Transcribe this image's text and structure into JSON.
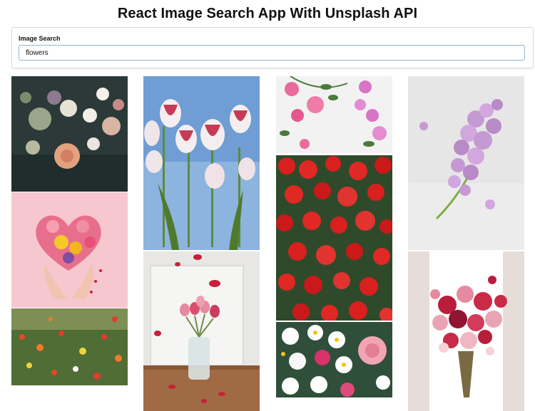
{
  "header": {
    "title": "React Image Search App With Unsplash API"
  },
  "search": {
    "label": "Image Search",
    "value": "flowers"
  },
  "gallery": {
    "photos": [
      {
        "icon": "bouquet-image"
      },
      {
        "icon": "heart-flowers-image"
      },
      {
        "icon": "wildflower-meadow-image"
      },
      {
        "icon": "tulips-image"
      },
      {
        "icon": "tulip-vase-image"
      },
      {
        "icon": "pink-flower-frame-image"
      },
      {
        "icon": "red-flower-field-image"
      },
      {
        "icon": "plumeria-flowers-image"
      },
      {
        "icon": "lilac-image"
      },
      {
        "icon": "bridal-bouquet-image"
      }
    ]
  }
}
